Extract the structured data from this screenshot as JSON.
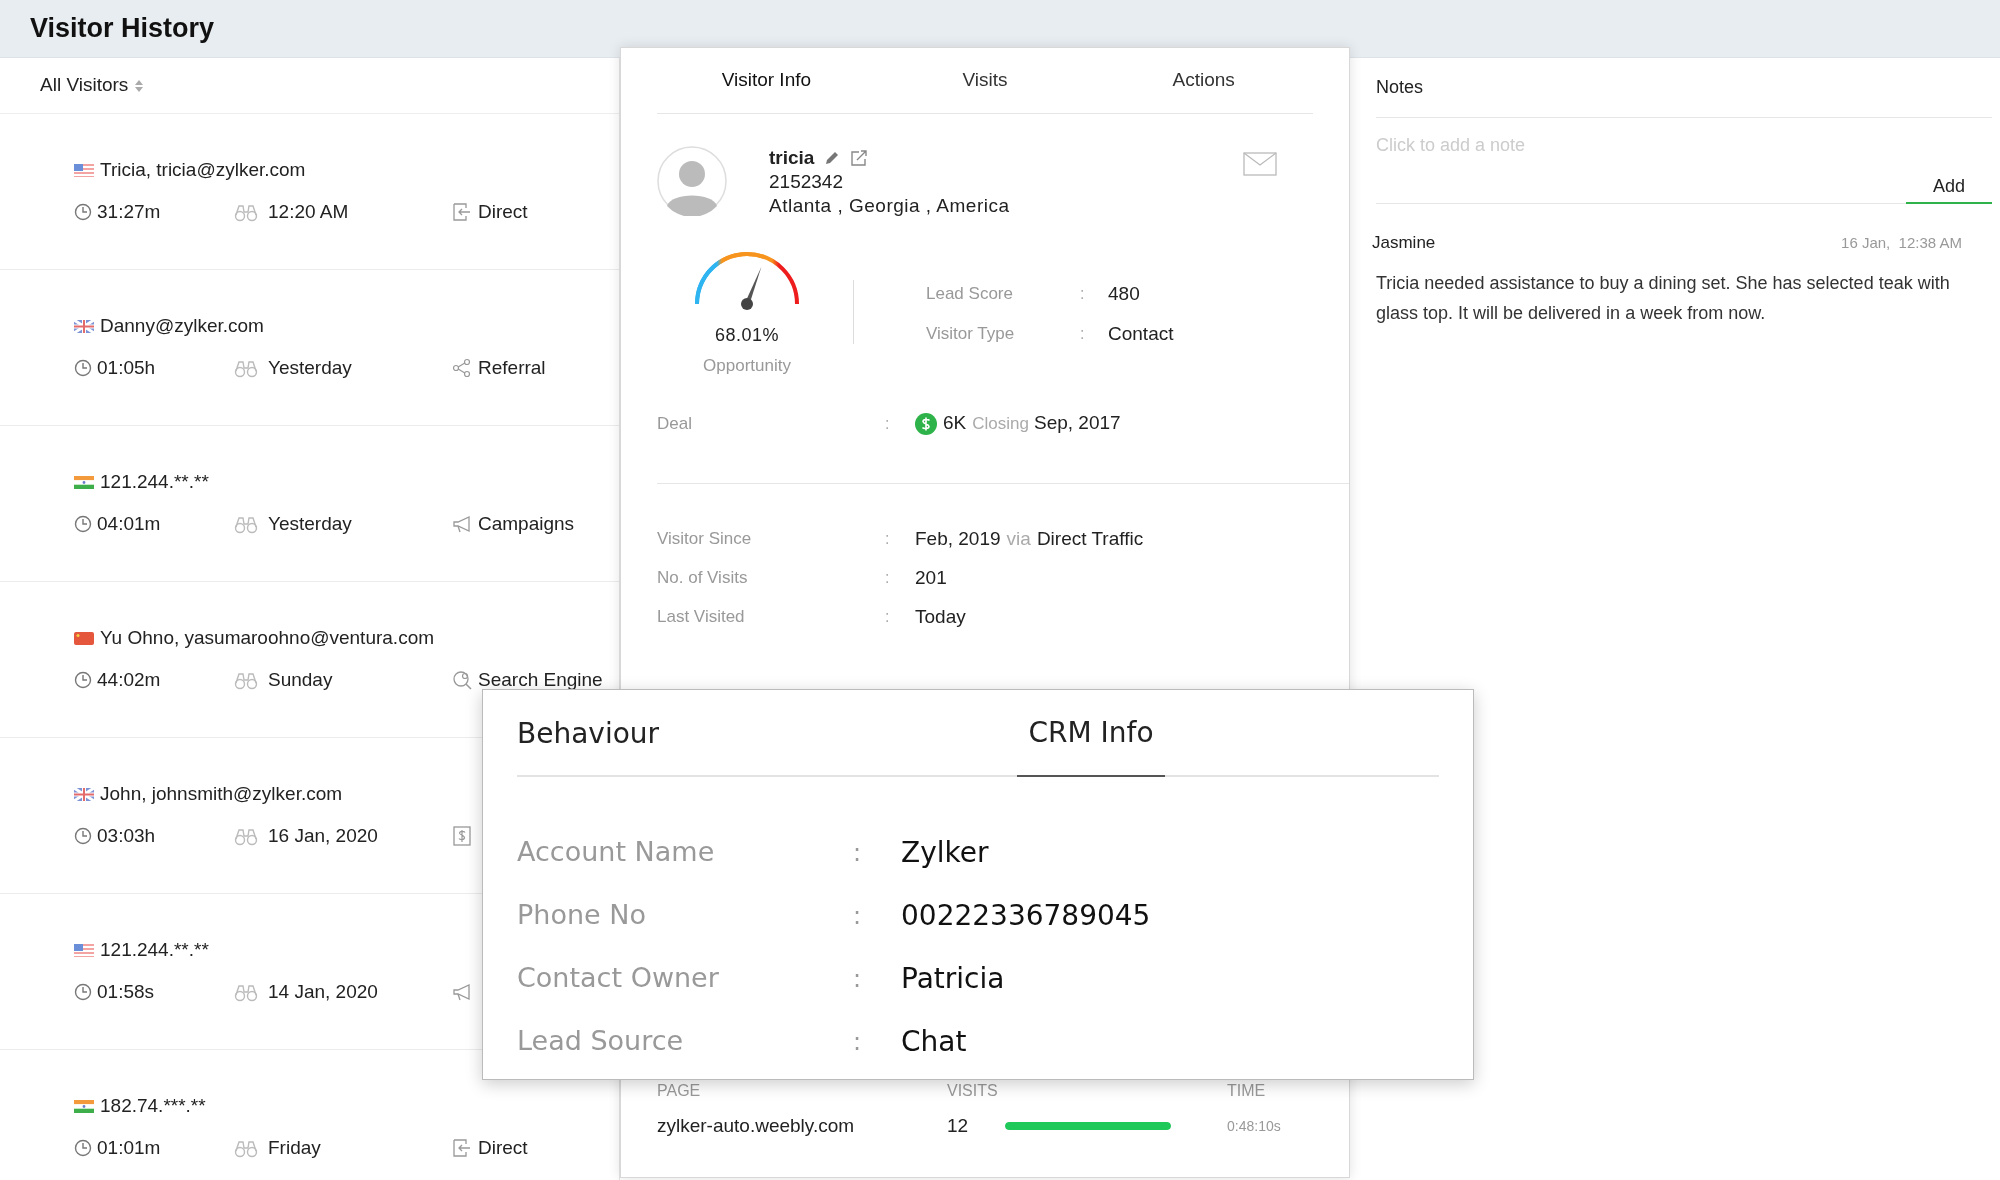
{
  "page": {
    "title": "Visitor History"
  },
  "filter": {
    "label": "All Visitors"
  },
  "visitors": [
    {
      "flag": {
        "kind": "us"
      },
      "name": "Tricia, tricia@zylker.com",
      "duration": "31:27m",
      "last_seen": "12:20 AM",
      "source": {
        "kind": "direct",
        "label": "Direct"
      }
    },
    {
      "flag": {
        "kind": "uk"
      },
      "name": "Danny@zylker.com",
      "duration": "01:05h",
      "last_seen": "Yesterday",
      "source": {
        "kind": "referral",
        "label": "Referral"
      }
    },
    {
      "flag": {
        "kind": "in"
      },
      "name": "121.244.**.**",
      "duration": "04:01m",
      "last_seen": "Yesterday",
      "source": {
        "kind": "campaign",
        "label": "Campaigns"
      }
    },
    {
      "flag": {
        "kind": "cn"
      },
      "name": "Yu Ohno, yasumaroohno@ventura.com",
      "duration": "44:02m",
      "last_seen": "Sunday",
      "source": {
        "kind": "search",
        "label": "Search Engine"
      }
    },
    {
      "flag": {
        "kind": "uk"
      },
      "name": "John, johnsmith@zylker.com",
      "duration": "03:03h",
      "last_seen": "16 Jan, 2020",
      "source": {
        "kind": "ads"
      }
    },
    {
      "flag": {
        "kind": "us"
      },
      "name": "121.244.**.**",
      "duration": "01:58s",
      "last_seen": "14 Jan, 2020",
      "source": {
        "kind": "campaign"
      }
    },
    {
      "flag": {
        "kind": "in"
      },
      "name": "182.74.***.**",
      "duration": "01:01m",
      "last_seen": "Friday",
      "source": {
        "kind": "direct",
        "label": "Direct"
      }
    }
  ],
  "detail": {
    "tabs": [
      {
        "label": "Visitor Info",
        "selected": true
      },
      {
        "label": "Visits",
        "selected": false
      },
      {
        "label": "Actions",
        "selected": false
      }
    ],
    "name": "tricia",
    "id": "2152342",
    "location": "Atlanta , Georgia , America",
    "gauge": {
      "level": 0.68,
      "value": "68.01%",
      "label": "Opportunity"
    },
    "scores": [
      {
        "label": "Lead Score",
        "colon": ":",
        "value": "480"
      },
      {
        "label": "Visitor Type",
        "colon": ":",
        "value": "Contact"
      }
    ],
    "deal": {
      "label": "Deal",
      "colon": ":",
      "amount": "6K",
      "closing_label": "Closing",
      "closing": "Sep, 2017"
    },
    "info": [
      {
        "label": "Visitor Since",
        "colon": ":",
        "value": "Feb, 2019",
        "via_label": "via",
        "via": "Direct Traffic"
      },
      {
        "label": "No. of Visits",
        "colon": ":",
        "value": "201"
      },
      {
        "label": "Last Visited",
        "colon": ":",
        "value": "Today"
      }
    ],
    "pages": {
      "columns": [
        "PAGE",
        "VISITS",
        "TIME"
      ],
      "rows": [
        {
          "page": "zylker-auto.weebly.com",
          "visits": "12",
          "level": 1,
          "time": "0:48:10s"
        }
      ]
    }
  },
  "notes": {
    "title": "Notes",
    "placeholder": "Click to add a note",
    "add": "Add",
    "items": [
      {
        "author": "Jasmine",
        "time": "16 Jan,  12:38 AM",
        "text": "Tricia needed assistance to buy a dining set. She has selected teak with glass top. It will be delivered in a week from now."
      }
    ]
  },
  "crm": {
    "tabs": [
      {
        "label": "Behaviour",
        "selected": false
      },
      {
        "label": "CRM Info",
        "selected": true
      }
    ],
    "fields": [
      {
        "label": "Account Name",
        "colon": ":",
        "value": "Zylker"
      },
      {
        "label": "Phone No",
        "colon": ":",
        "value": "00222336789045"
      },
      {
        "label": "Contact Owner",
        "colon": ":",
        "value": "Patricia"
      },
      {
        "label": "Lead Source",
        "colon": ":",
        "value": "Chat"
      }
    ]
  }
}
